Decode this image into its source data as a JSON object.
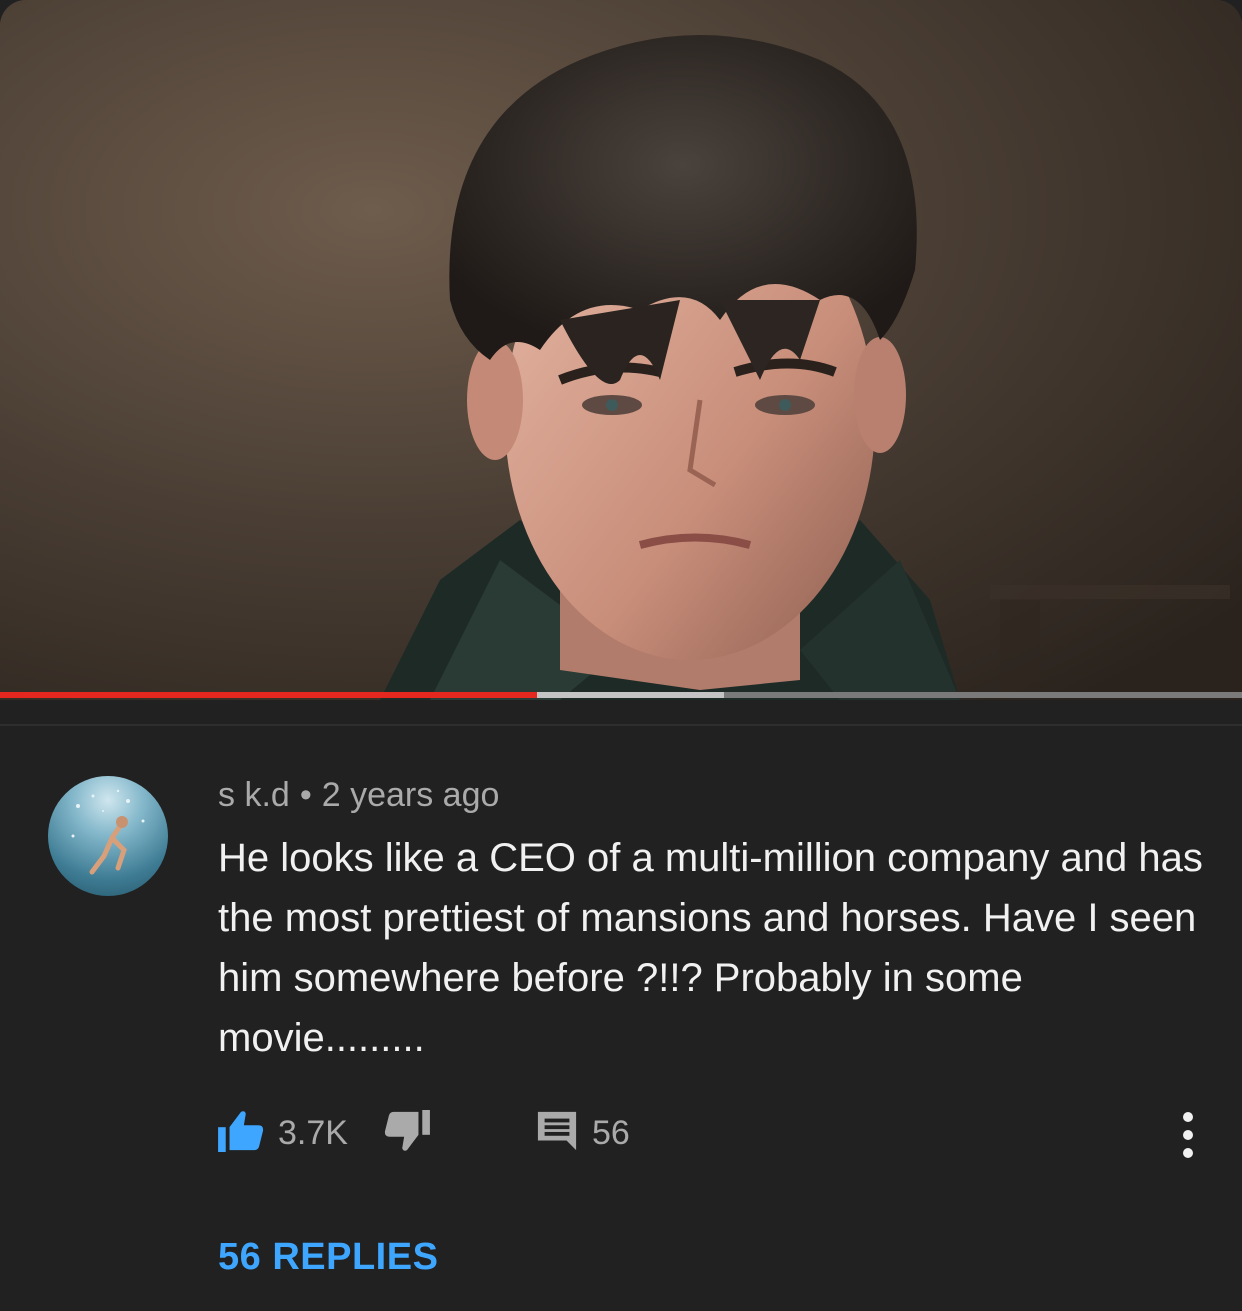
{
  "video": {
    "progress": {
      "played_fraction": 0.432,
      "buffered_fraction": 0.583
    }
  },
  "comment": {
    "author": "s k.d",
    "separator": "•",
    "timestamp": "2 years ago",
    "text": "He looks like a CEO of a multi-million company and has the most prettiest of mansions and horses. Have I seen him somewhere before ?!!? Probably in some movie.........",
    "actions": {
      "likes": "3.7K",
      "reply_count": "56"
    },
    "view_replies_label": "56 REPLIES"
  },
  "colors": {
    "background": "#212121",
    "text_primary": "#f1f1f1",
    "text_secondary": "#aaaaaa",
    "accent_blue": "#3ea6ff",
    "progress_red": "#e5281f"
  },
  "icons": {
    "like": "thumbs-up-icon",
    "dislike": "thumbs-down-icon",
    "reply": "comment-icon",
    "more": "more-vertical-icon"
  }
}
